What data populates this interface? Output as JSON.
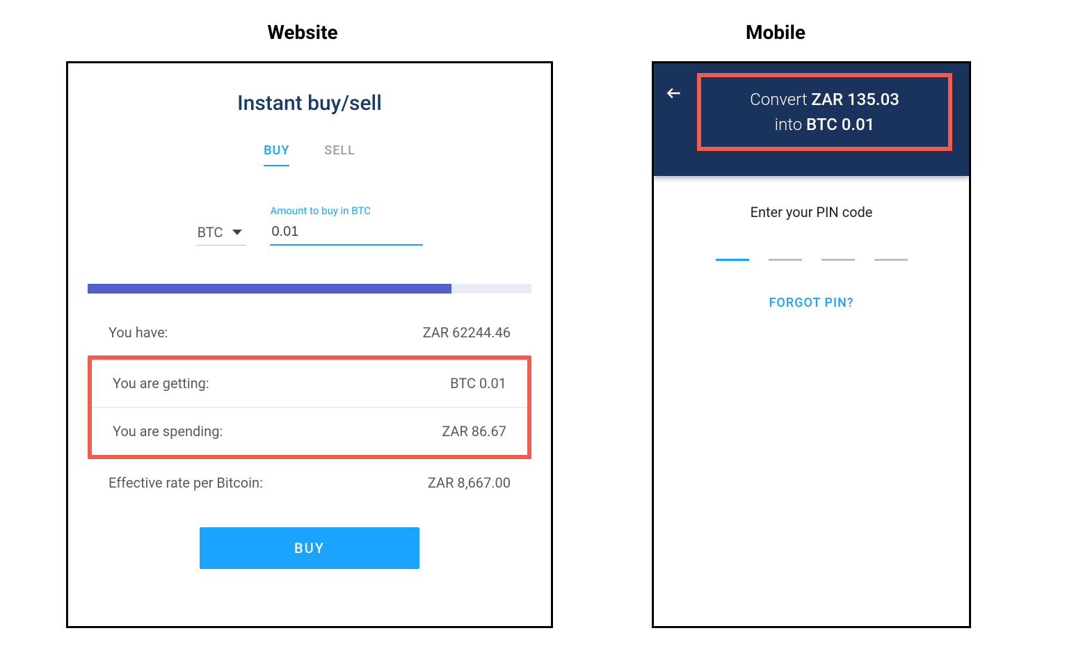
{
  "headings": {
    "website": "Website",
    "mobile": "Mobile"
  },
  "website": {
    "title": "Instant buy/sell",
    "tabs": {
      "buy": "BUY",
      "sell": "SELL"
    },
    "currencySelect": "BTC",
    "amountField": {
      "label": "Amount to buy in BTC",
      "value": "0.01"
    },
    "rows": {
      "have": {
        "label": "You have:",
        "value": "ZAR 62244.46"
      },
      "getting": {
        "label": "You are getting:",
        "value": "BTC 0.01"
      },
      "spending": {
        "label": "You are spending:",
        "value": "ZAR 86.67"
      },
      "rate": {
        "label": "Effective rate per Bitcoin:",
        "value": "ZAR 8,667.00"
      }
    },
    "buyButton": "BUY"
  },
  "mobile": {
    "header": {
      "line1_prefix": "Convert ",
      "line1_amount": "ZAR 135.03",
      "line2_prefix": "into ",
      "line2_amount": "BTC 0.01"
    },
    "prompt": "Enter your PIN code",
    "forgot": "FORGOT PIN?"
  }
}
